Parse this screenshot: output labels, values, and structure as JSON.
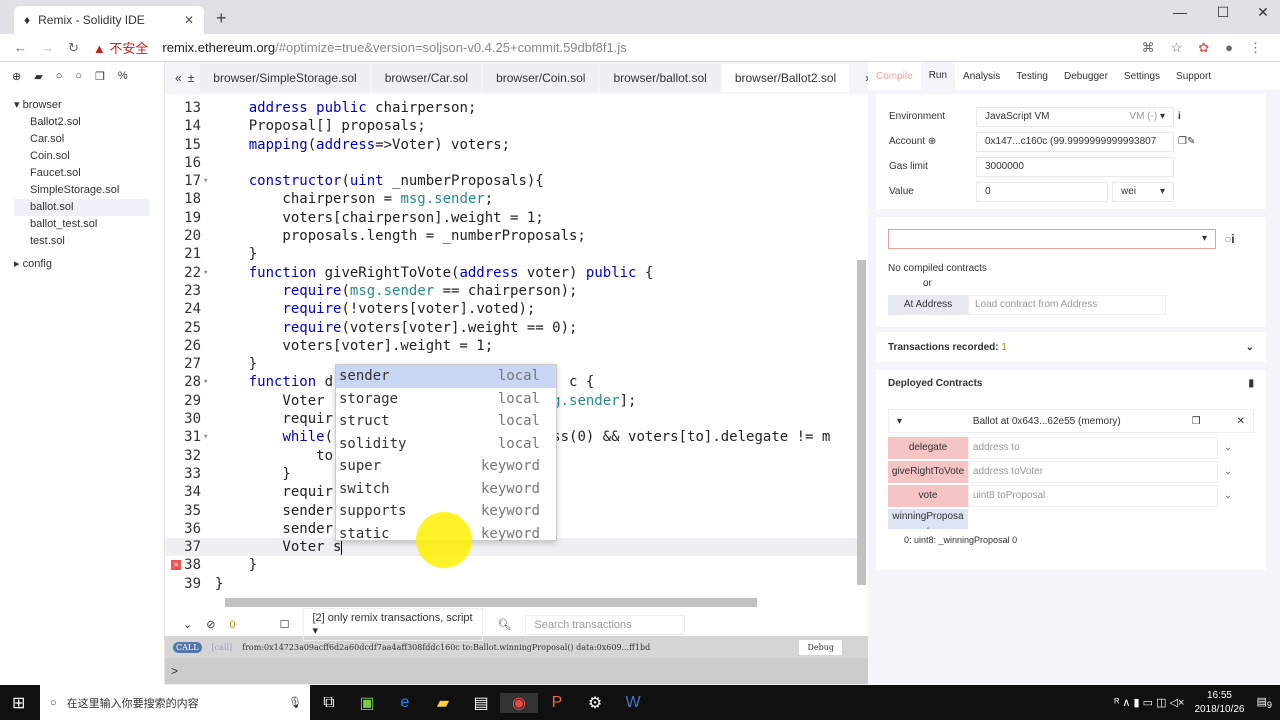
{
  "browser": {
    "tab_title": "Remix - Solidity IDE",
    "security_label": "不安全",
    "url_host": "remix.ethereum.org",
    "url_rest": "/#optimize=true&version=soljson-v0.4.25+commit.59dbf8f1.js"
  },
  "file_tree": {
    "root": "browser",
    "files": [
      "Ballot2.sol",
      "Car.sol",
      "Coin.sol",
      "Faucet.sol",
      "SimpleStorage.sol",
      "ballot.sol",
      "ballot_test.sol",
      "test.sol"
    ],
    "selected": "ballot.sol",
    "config": "config"
  },
  "editor": {
    "tabs": [
      "browser/SimpleStorage.sol",
      "browser/Car.sol",
      "browser/Coin.sol",
      "browser/ballot.sol",
      "browser/Ballot2.sol"
    ],
    "active_tab": "browser/Ballot2.sol",
    "lines": [
      {
        "n": "13",
        "t": "    address public chairperson;"
      },
      {
        "n": "14",
        "t": "    Proposal[] proposals;"
      },
      {
        "n": "15",
        "t": "    mapping(address=>Voter) voters;"
      },
      {
        "n": "16",
        "t": ""
      },
      {
        "n": "17",
        "t": "    constructor(uint _numberProposals){",
        "fold": true
      },
      {
        "n": "18",
        "t": "        chairperson = msg.sender;"
      },
      {
        "n": "19",
        "t": "        voters[chairperson].weight = 1;"
      },
      {
        "n": "20",
        "t": "        proposals.length = _numberProposals;"
      },
      {
        "n": "21",
        "t": "    }"
      },
      {
        "n": "22",
        "t": "    function giveRightToVote(address voter) public {",
        "fold": true
      },
      {
        "n": "23",
        "t": "        require(msg.sender == chairperson);"
      },
      {
        "n": "24",
        "t": "        require(!voters[voter].voted);"
      },
      {
        "n": "25",
        "t": "        require(voters[voter].weight == 0);"
      },
      {
        "n": "26",
        "t": "        voters[voter].weight = 1;"
      },
      {
        "n": "27",
        "t": "    }"
      },
      {
        "n": "28",
        "t": "    function d                            c {",
        "fold": true
      },
      {
        "n": "29",
        "t": "        Voter                          sg.sender];"
      },
      {
        "n": "30",
        "t": "        requir"
      },
      {
        "n": "31",
        "t": "        while(                         ess(0) && voters[to].delegate != m",
        "fold": true
      },
      {
        "n": "32",
        "t": "            to"
      },
      {
        "n": "33",
        "t": "        }"
      },
      {
        "n": "34",
        "t": "        requir"
      },
      {
        "n": "35",
        "t": "        sender"
      },
      {
        "n": "36",
        "t": "        sender"
      },
      {
        "n": "37",
        "t": "        Voter s",
        "current": true
      },
      {
        "n": "38",
        "t": "    }",
        "error": true
      },
      {
        "n": "39",
        "t": "}"
      }
    ]
  },
  "autocomplete": [
    {
      "word": "sender",
      "meta": "local"
    },
    {
      "word": "storage",
      "meta": "local"
    },
    {
      "word": "struct",
      "meta": "local"
    },
    {
      "word": "solidity",
      "meta": "local"
    },
    {
      "word": "super",
      "meta": "keyword"
    },
    {
      "word": "switch",
      "meta": "keyword"
    },
    {
      "word": "supports",
      "meta": "keyword"
    },
    {
      "word": "static",
      "meta": "keyword"
    }
  ],
  "terminal": {
    "pending_count": "0",
    "filter": "[2] only remix transactions, script",
    "search_placeholder": "Search transactions",
    "log_tag": "[call]",
    "log_text": "from:0x14723a09acff6d2a60dcdf7aa4aff308fddc160c to:Ballot.winningProposal() data:0x609...ff1bd",
    "debug_label": "Debug",
    "prompt": ">"
  },
  "right_panel": {
    "tabs": [
      "Compile",
      "Run",
      "Analysis",
      "Testing",
      "Debugger",
      "Settings",
      "Support"
    ],
    "active_tab": "Run",
    "environment_label": "Environment",
    "environment_value": "JavaScript VM",
    "environment_badge": "VM (-)",
    "account_label": "Account",
    "account_value": "0x147...c160c (99.9999999999993807",
    "gas_label": "Gas limit",
    "gas_value": "3000000",
    "value_label": "Value",
    "value_value": "0",
    "value_unit": "wei",
    "no_contracts": "No compiled contracts",
    "or": "or",
    "at_address": "At Address",
    "at_address_placeholder": "Load contract from Address",
    "tx_recorded": "Transactions recorded:",
    "tx_count": "1",
    "deployed_title": "Deployed Contracts",
    "instance_title": "Ballot at 0x643...62e55 (memory)",
    "functions": [
      {
        "name": "delegate",
        "param": "address to"
      },
      {
        "name": "giveRightToVote",
        "param": "address toVoter"
      },
      {
        "name": "vote",
        "param": "uint8 toProposal"
      }
    ],
    "call_fn": "winningProposa\nl",
    "call_result": "0: uint8: _winningProposal 0"
  },
  "taskbar": {
    "search_placeholder": "在这里输入你要搜索的内容",
    "time": "16:55",
    "date": "2018/10/26",
    "notif_count": "9"
  }
}
